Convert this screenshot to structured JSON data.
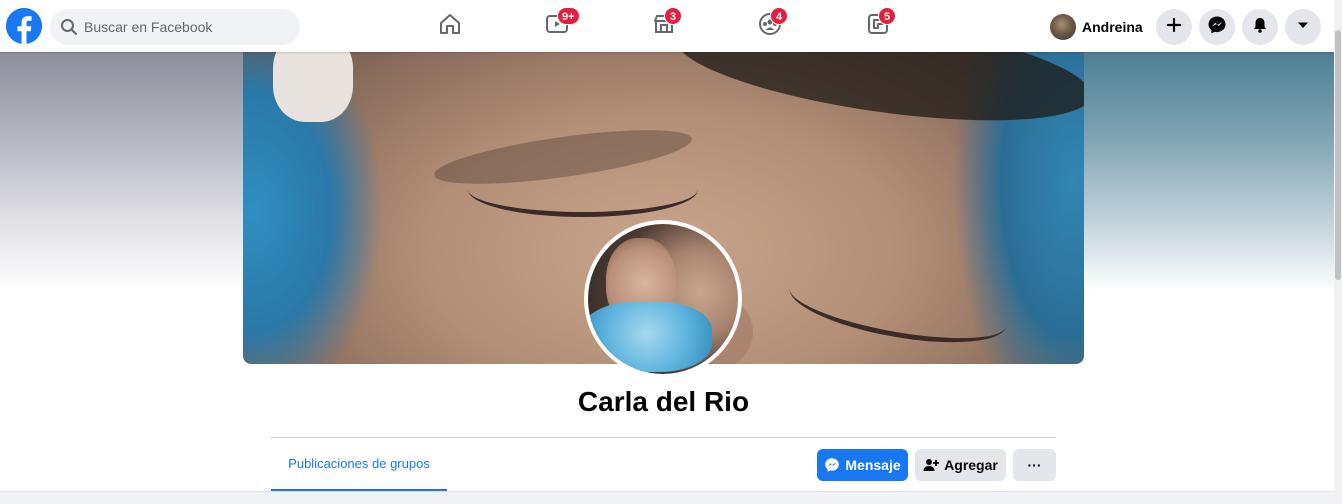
{
  "topbar": {
    "search_placeholder": "Buscar en Facebook",
    "nav": [
      {
        "icon": "home-icon",
        "badge": ""
      },
      {
        "icon": "watch-icon",
        "badge": "9+"
      },
      {
        "icon": "marketplace-icon",
        "badge": "3"
      },
      {
        "icon": "groups-icon",
        "badge": "4"
      },
      {
        "icon": "gaming-icon",
        "badge": "5"
      }
    ],
    "user_name": "Andreina"
  },
  "profile": {
    "name": "Carla del Rio"
  },
  "tabs": {
    "group_posts": "Publicaciones de grupos"
  },
  "actions": {
    "message": "Mensaje",
    "add": "Agregar",
    "more": "···"
  },
  "colors": {
    "brand": "#1877f2",
    "badge": "#e41e3f"
  }
}
